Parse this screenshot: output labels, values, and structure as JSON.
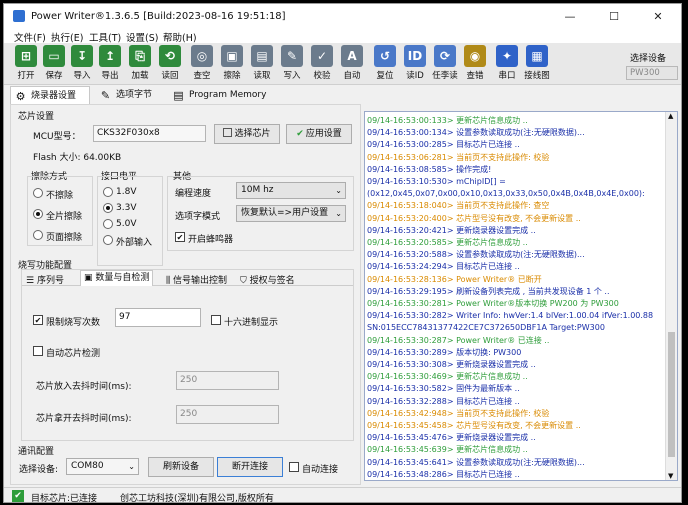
{
  "window": {
    "title": "Power Writer®1.3.6.5 [Build:2023-08-16 19:51:18]",
    "minimize_glyph": "—",
    "maximize_glyph": "☐",
    "close_glyph": "✕"
  },
  "menu": [
    "文件(F)",
    "执行(E)",
    "工具(T)",
    "设置(S)",
    "帮助(H)"
  ],
  "toolbar": {
    "buttons": [
      {
        "label": "打开",
        "icon": "folder-open-icon",
        "color": "#2f8a3c"
      },
      {
        "label": "保存",
        "icon": "save-icon",
        "color": "#2f8a3c"
      },
      {
        "label": "导入",
        "icon": "import-icon",
        "color": "#2f8a3c"
      },
      {
        "label": "导出",
        "icon": "export-icon",
        "color": "#2f8a3c"
      },
      {
        "label": "加载",
        "icon": "load-icon",
        "color": "#2f8a3c"
      },
      {
        "label": "读回",
        "icon": "read-back-icon",
        "color": "#2f8a3c"
      },
      {
        "label": "查空",
        "icon": "blank-check-icon",
        "color": "#6b7b8c"
      },
      {
        "label": "擦除",
        "icon": "erase-icon",
        "color": "#6b7b8c"
      },
      {
        "label": "读取",
        "icon": "read-icon",
        "color": "#6b7b8c"
      },
      {
        "label": "写入",
        "icon": "write-icon",
        "color": "#6b7b8c"
      },
      {
        "label": "校验",
        "icon": "verify-icon",
        "color": "#6b7b8c"
      },
      {
        "label": "自动",
        "icon": "auto-icon",
        "color": "#6b7b8c"
      },
      {
        "label": "复位",
        "icon": "reset-icon",
        "color": "#4a78c8"
      },
      {
        "label": "读ID",
        "icon": "read-id-icon",
        "color": "#4a78c8"
      },
      {
        "label": "任李读",
        "icon": "task-read-icon",
        "color": "#4a78c8"
      },
      {
        "label": "查错",
        "icon": "error-check-icon",
        "color": "#b08a18"
      },
      {
        "label": "串口",
        "icon": "serial-port-icon",
        "color": "#2f62c8"
      },
      {
        "label": "接线图",
        "icon": "wiring-diagram-icon",
        "color": "#2f62c8"
      }
    ],
    "device_select_label": "选择设备",
    "device_select_value": "PW300"
  },
  "tabs": [
    {
      "label": "烧录器设置",
      "icon": "gear-icon",
      "glyph": "⚙"
    },
    {
      "label": "选项字节",
      "icon": "option-bytes-icon",
      "glyph": "✎"
    },
    {
      "label": "Program Memory",
      "icon": "memory-icon",
      "glyph": "▤"
    }
  ],
  "chip": {
    "group_label": "芯片设置",
    "mcu_label": "MCU型号：",
    "mcu_value": "CKS32F030x8",
    "select_chip_button": "选择芯片",
    "apply_button": "应用设置",
    "flash_label": "Flash 大小: 64.00KB"
  },
  "erase": {
    "label": "擦除方式",
    "options": [
      "不擦除",
      "全片擦除",
      "页面擦除"
    ],
    "selected": 1
  },
  "voltage": {
    "label": "接口电平",
    "options": [
      "1.8V",
      "3.3V",
      "5.0V",
      "外部输入"
    ],
    "selected": 1
  },
  "other": {
    "label": "其他",
    "speed_label": "编程速度",
    "speed_value": "10M hz",
    "option_mode_label": "选项字模式",
    "option_mode_value": "恢复默认=>用户设置",
    "buzzer_label": "开启蜂鸣器",
    "buzzer_checked": true
  },
  "burn": {
    "group_label": "烧写功能配置",
    "subtabs": [
      "序列号",
      "数量与自检测",
      "信号输出控制",
      "授权与签名"
    ],
    "subtab_active": 1,
    "limit_label": "限制烧写次数",
    "limit_checked": true,
    "limit_value": "97",
    "hex_label": "十六进制显示",
    "hex_checked": false,
    "auto_detect_label": "自动芯片检测",
    "auto_detect_checked": false,
    "insert_label": "芯片放入去抖时间(ms):",
    "insert_value": "250",
    "remove_label": "芯片拿开去抖时间(ms):",
    "remove_value": "250"
  },
  "comm": {
    "group_label": "通讯配置",
    "device_label": "选择设备:",
    "device_value": "COM80",
    "refresh_button": "刷新设备",
    "disconnect_button": "断开连接",
    "auto_connect_label": "自动连接"
  },
  "log": [
    {
      "text": "09/14-16:53:00:133> 更新芯片信息成功 ..",
      "color": "#2e9d3a"
    },
    {
      "text": "09/14-16:53:00:134> 设置参数读取成功(注:无硬限数据)...",
      "color": "#1a2fa8"
    },
    {
      "text": "09/14-16:53:00:285> 目标芯片已连接 ..",
      "color": "#1a2fa8"
    },
    {
      "text": "09/14-16:53:06:281> 当前页不支持此操作: 校验",
      "color": "#d98a00"
    },
    {
      "text": "09/14-16:53:08:585> 操作完成!",
      "color": "#1a2fa8"
    },
    {
      "text": "09/14-16:53:10:530> mChipID[] =",
      "color": "#1a2fa8"
    },
    {
      "text": "(0x12,0x45,0x07,0x00,0x10,0x13,0x33,0x50,0x4B,0x4B,0x4E,0x00):",
      "color": "#1a2fa8"
    },
    {
      "text": "09/14-16:53:18:040> 当前页不支持此操作: 查空",
      "color": "#d98a00"
    },
    {
      "text": "09/14-16:53:20:400> 芯片型号没有改变, 不会更新设置 ..",
      "color": "#d98a00"
    },
    {
      "text": "09/14-16:53:20:421> 更新烧录器设置完成 ..",
      "color": "#1a2fa8"
    },
    {
      "text": "09/14-16:53:20:585> 更新芯片信息成功 ..",
      "color": "#2e9d3a"
    },
    {
      "text": "09/14-16:53:20:588> 设置参数读取成功(注:无硬限数据)...",
      "color": "#1a2fa8"
    },
    {
      "text": "09/14-16:53:24:294> 目标芯片已连接 ..",
      "color": "#1a2fa8"
    },
    {
      "text": "09/14-16:53:28:136> Power Writer® 已断开",
      "color": "#d98a00"
    },
    {
      "text": "09/14-16:53:29:195> 刷新设备列表完成 , 当前共发现设备 1 个 ..",
      "color": "#1a2fa8"
    },
    {
      "text": "09/14-16:53:30:281> Power Writer®版本切换    PW200 为 PW300",
      "color": "#2e9d3a"
    },
    {
      "text": "09/14-16:53:30:282> Writer Info: hwVer:1.4   blVer:1.00.04   ifVer:1.00.88",
      "color": "#1a2fa8"
    },
    {
      "text": "SN:015ECC78431377422CE7C372650DBF1A Target:PW300",
      "color": "#1a2fa8"
    },
    {
      "text": "09/14-16:53:30:287> Power Writer® 已连接 ..",
      "color": "#2e9d3a"
    },
    {
      "text": "09/14-16:53:30:289> 版本切换: PW300",
      "color": "#1a2fa8"
    },
    {
      "text": "09/14-16:53:30:308> 更新烧录器设置完成 ..",
      "color": "#1a2fa8"
    },
    {
      "text": "09/14-16:53:30:469> 更新芯片信息成功 ..",
      "color": "#2e9d3a"
    },
    {
      "text": "09/14-16:53:30:582> 固件为最新版本 ..",
      "color": "#1a2fa8"
    },
    {
      "text": "09/14-16:53:32:288> 目标芯片已连接 ..",
      "color": "#1a2fa8"
    },
    {
      "text": "09/14-16:53:42:948> 当前页不支持此操作: 校验",
      "color": "#d98a00"
    },
    {
      "text": "09/14-16:53:45:458> 芯片型号没有改变, 不会更新设置 ..",
      "color": "#d98a00"
    },
    {
      "text": "09/14-16:53:45:476> 更新烧录器设置完成 ..",
      "color": "#1a2fa8"
    },
    {
      "text": "09/14-16:53:45:639> 更新芯片信息成功 ..",
      "color": "#2e9d3a"
    },
    {
      "text": "09/14-16:53:45:641> 设置参数读取成功(注:无硬限数据)...",
      "color": "#1a2fa8"
    },
    {
      "text": "09/14-16:53:48:286> 目标芯片已连接 ..",
      "color": "#1a2fa8"
    }
  ],
  "status": {
    "target_label": "目标芯片:已连接",
    "copyright": "创芯工坊科技(深圳)有限公司,版权所有",
    "indicator_color": "#2e9d3a"
  }
}
